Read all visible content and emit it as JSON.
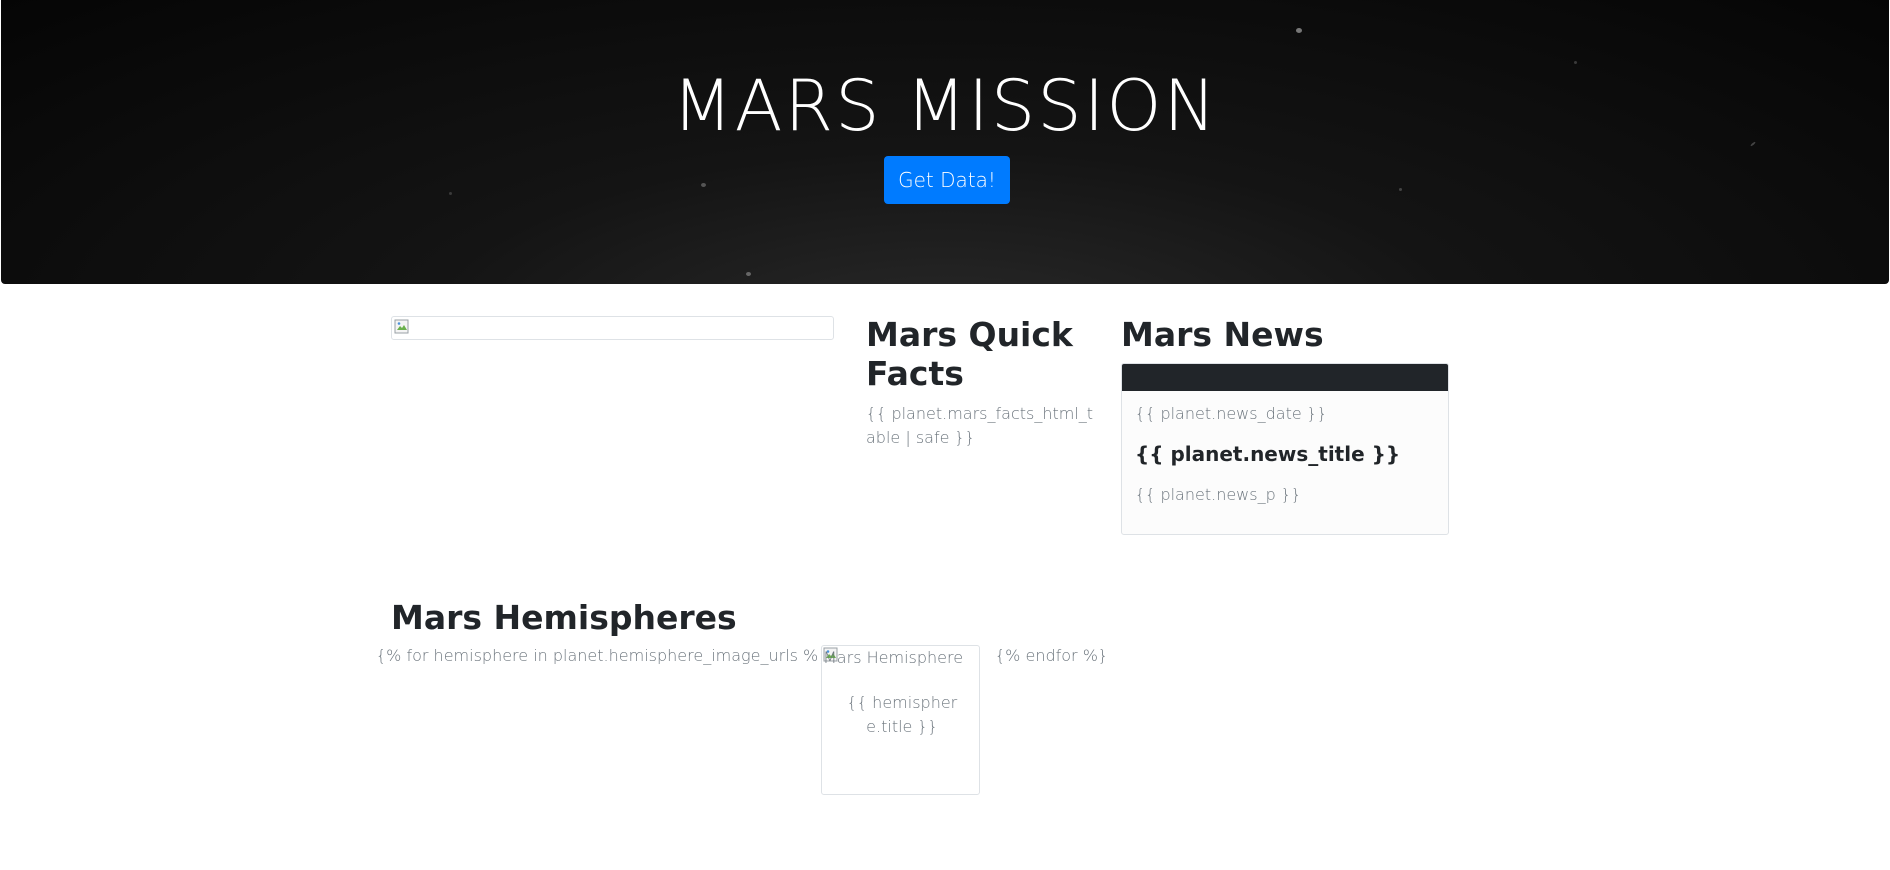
{
  "hero": {
    "title": "MARS MISSION",
    "button_label": "Get Data!",
    "button_color": "#007bff"
  },
  "featured_image": {
    "icon": "broken-image-icon"
  },
  "facts": {
    "heading": "Mars Quick Facts",
    "body": "{{ planet.mars_facts_html_table | safe }}"
  },
  "news": {
    "heading": "Mars News",
    "date": "{{ planet.news_date }}",
    "title": "{{ planet.news_title }}",
    "paragraph": "{{ planet.news_p }}",
    "header_color": "#212529"
  },
  "hemispheres": {
    "heading": "Mars Hemispheres",
    "loop_start": "{% for hemisphere in planet.hemisphere_image_urls %}",
    "loop_end": "{% endfor %}",
    "image_alt": "Mars Hemisphere",
    "caption": "{{ hemisphere.title }}",
    "icon": "broken-image-icon"
  }
}
